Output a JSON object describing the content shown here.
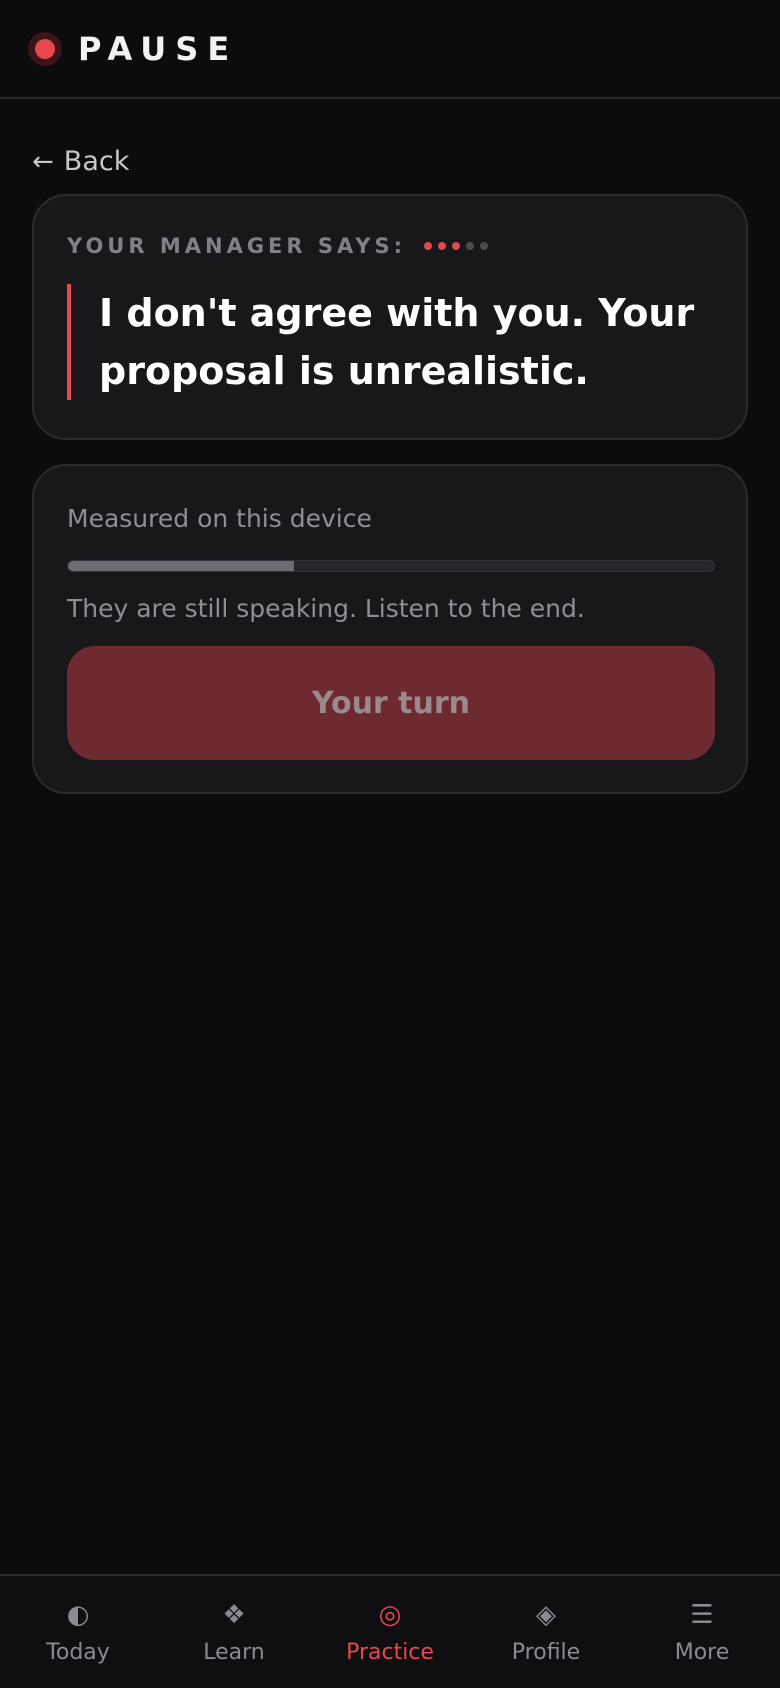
{
  "header": {
    "brand": "PAUSE"
  },
  "back": {
    "arrow": "←",
    "label": "Back"
  },
  "quote_card": {
    "label": "YOUR MANAGER SAYS:",
    "progress": {
      "filled": 3,
      "total": 5
    },
    "quote": "I don't agree with you. Your proposal is unrealistic."
  },
  "measure_card": {
    "label": "Measured on this device",
    "progress_fraction": 0.35,
    "status": "They are still speaking. Listen to the end.",
    "button_label": "Your turn"
  },
  "nav": {
    "items": [
      {
        "label": "Today",
        "icon": "◐",
        "icon_name": "half-circle-icon"
      },
      {
        "label": "Learn",
        "icon": "❖",
        "icon_name": "diamond-cluster-icon"
      },
      {
        "label": "Practice",
        "icon": "◎",
        "icon_name": "target-icon"
      },
      {
        "label": "Profile",
        "icon": "◈",
        "icon_name": "diamond-icon"
      },
      {
        "label": "More",
        "icon": "☰",
        "icon_name": "menu-icon"
      }
    ],
    "active_index": 2
  },
  "colors": {
    "accent": "#e5484d",
    "background": "#0c0c0e",
    "card": "#18181b",
    "button": "#6e2a31"
  }
}
